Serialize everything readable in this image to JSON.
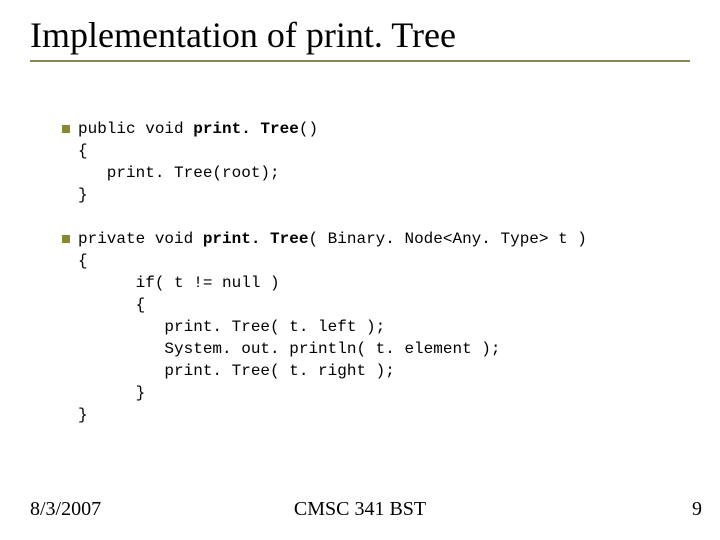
{
  "title": "Implementation of print. Tree",
  "code": {
    "l1a": "public void ",
    "l1b": "print. Tree",
    "l1c": "()",
    "l2": "{",
    "l3": "   print. Tree(root);",
    "l4": "}",
    "l5": "",
    "l6a": "private void ",
    "l6b": "print. Tree",
    "l6c": "( Binary. Node<Any. Type> t )",
    "l7": "{",
    "l8": "      if( t != null )",
    "l9": "      {",
    "l10": "         print. Tree( t. left );",
    "l11": "         System. out. println( t. element );",
    "l12": "         print. Tree( t. right );",
    "l13": "      }",
    "l14": "}"
  },
  "footer": {
    "date": "8/3/2007",
    "center": "CMSC 341 BST",
    "pagenum": "9"
  }
}
